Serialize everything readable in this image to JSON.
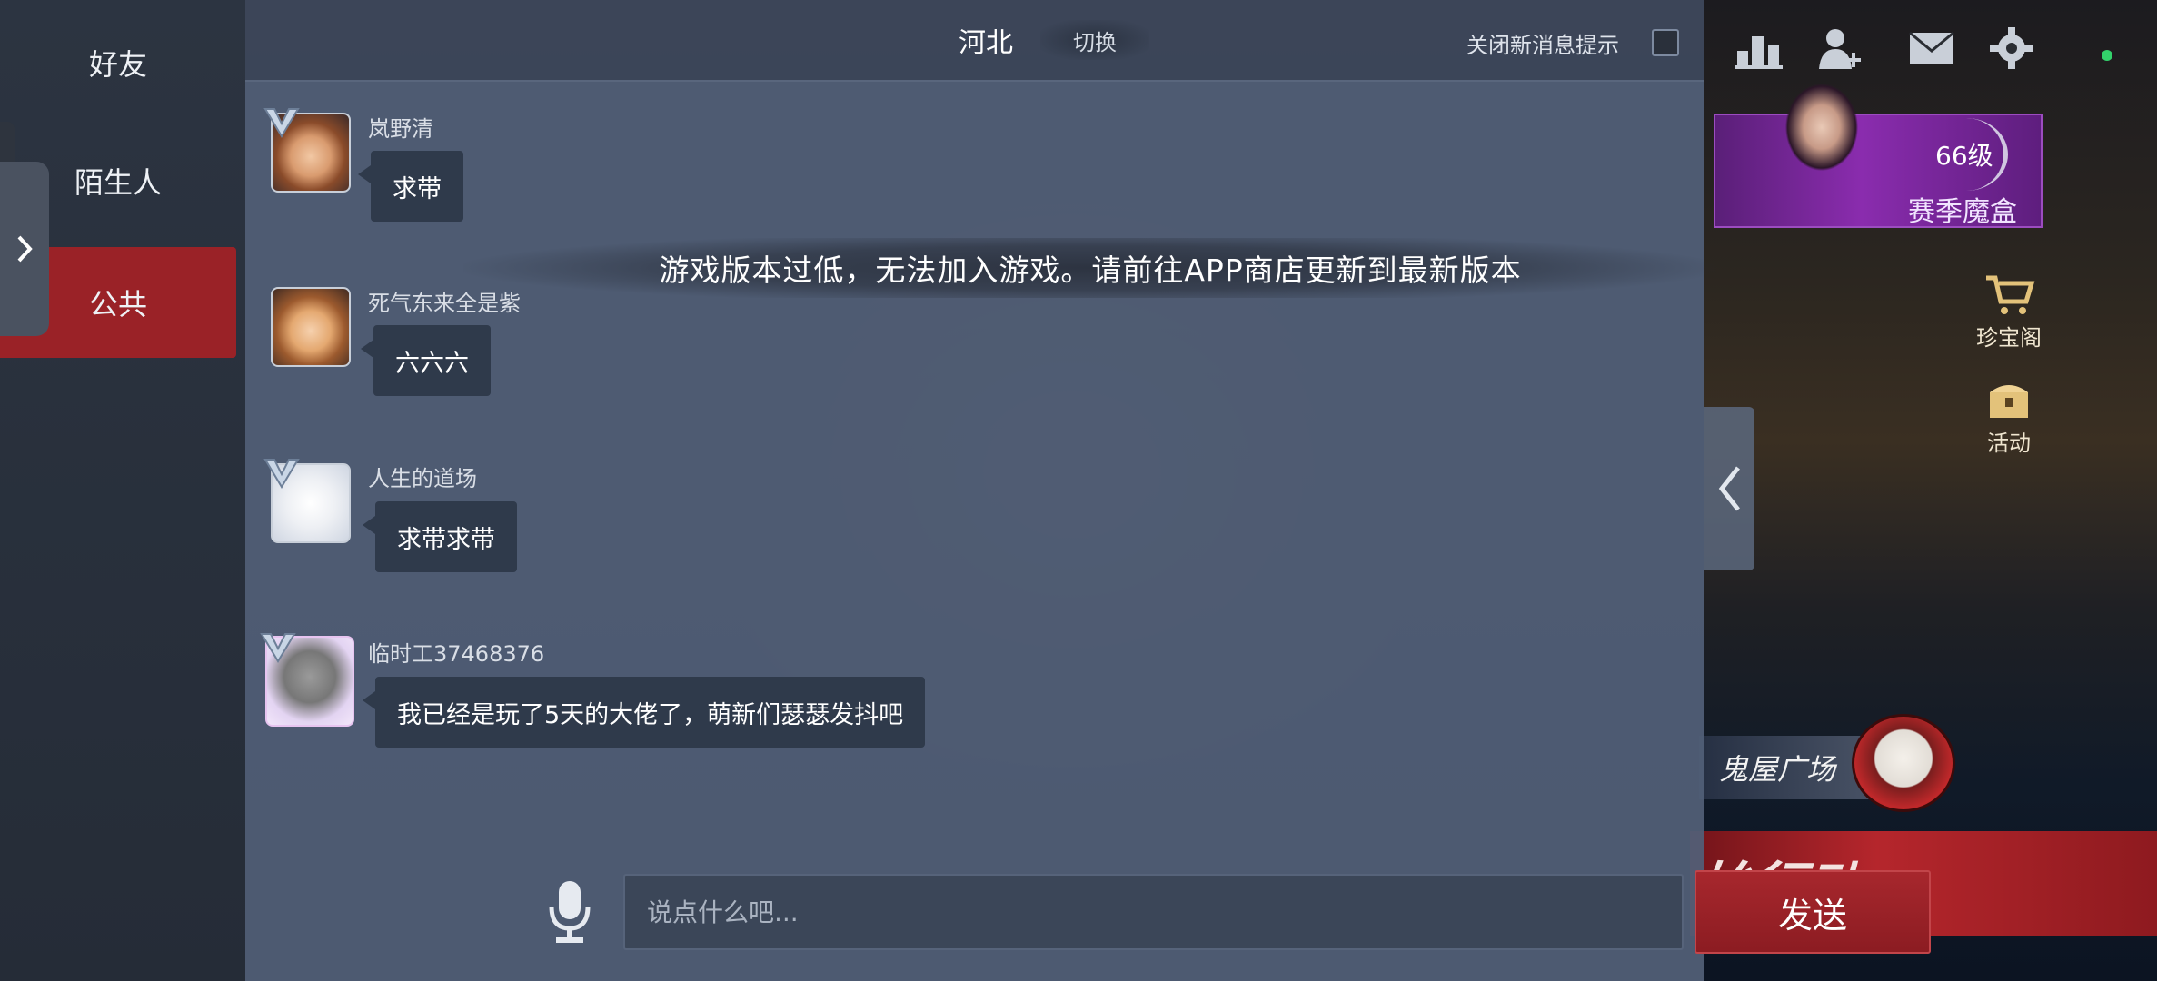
{
  "tabs": [
    {
      "label": "好友",
      "selected": false
    },
    {
      "label": "陌生人",
      "selected": false
    },
    {
      "label": "公共",
      "selected": true
    }
  ],
  "header": {
    "region": "河北",
    "switch_label": "切换",
    "mute_label": "关闭新消息提示",
    "mute_checked": false
  },
  "messages": [
    {
      "username": "岚野清",
      "text": "求带",
      "verified": true
    },
    {
      "username": "死气东来全是紫",
      "text": "六六六",
      "verified": false
    },
    {
      "username": "人生的道场",
      "text": "求带求带",
      "verified": true
    },
    {
      "username": "临时工37468376",
      "text": "我已经是玩了5天的大佬了，萌新们瑟瑟发抖吧",
      "verified": true
    }
  ],
  "toast": "游戏版本过低，无法加入游戏。请前往APP商店更新到最新版本",
  "input": {
    "placeholder": "说点什么吧...",
    "value": ""
  },
  "send_label": "发送",
  "game_ui": {
    "season_level": "66级",
    "season_label": "赛季魔盒",
    "treasure_label": "珍宝阁",
    "activity_label": "活动",
    "plaza_label": "鬼屋广场",
    "start_label": "始行动"
  },
  "colors": {
    "accent_red": "#9a2227",
    "panel": "#52607a",
    "bubble": "#2f3a4b"
  }
}
